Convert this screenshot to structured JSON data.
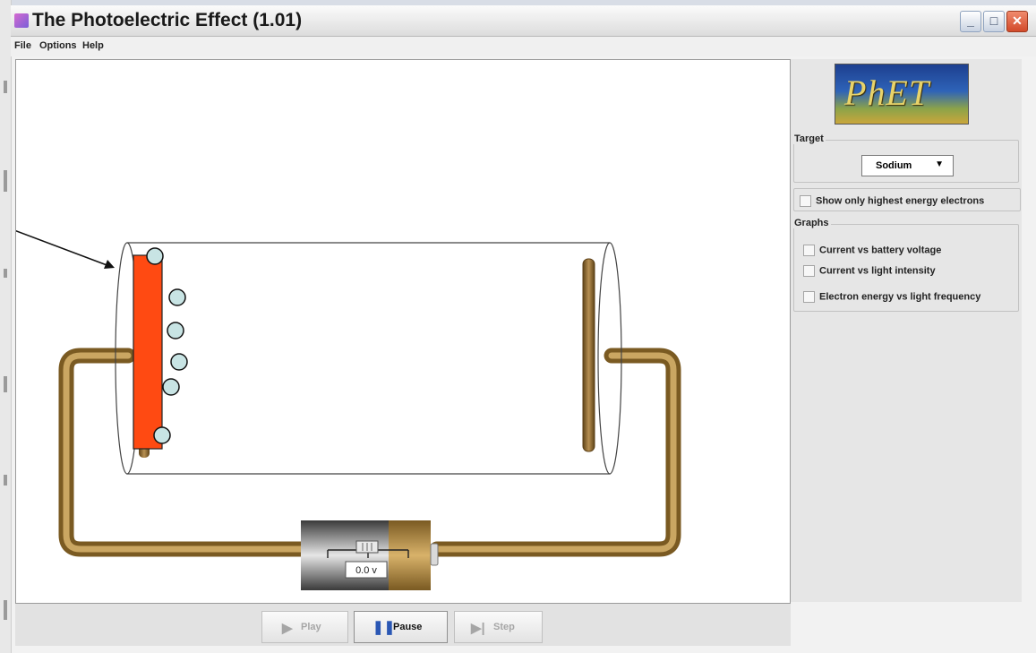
{
  "window": {
    "title": "The Photoelectric Effect (1.01)",
    "controls": {
      "minimize": "_",
      "maximize": "□",
      "close": "✕"
    }
  },
  "menu": {
    "items": [
      "File",
      "Options",
      "Help"
    ]
  },
  "simulation": {
    "battery_voltage": "0.0 v",
    "emitted_electrons": 6,
    "colors": {
      "target_plate": "#ff4a12",
      "electron": "#c8e4e4",
      "wire": "#8a6a2c"
    }
  },
  "control_panel": {
    "logo_text": "PhET",
    "target": {
      "label": "Target",
      "selected": "Sodium",
      "arrow": "▼"
    },
    "show_highest_energy": {
      "label": "Show only highest energy electrons",
      "checked": false
    },
    "graphs": {
      "label": "Graphs",
      "options": [
        {
          "label": "Current vs battery voltage",
          "checked": false
        },
        {
          "label": "Current vs light intensity",
          "checked": false
        },
        {
          "label": "Electron energy vs light frequency",
          "checked": false
        }
      ]
    }
  },
  "playback": {
    "play": {
      "label": "Play",
      "icon": "▶",
      "enabled": false
    },
    "pause": {
      "label": "Pause",
      "icon": "❚❚",
      "enabled": true
    },
    "step": {
      "label": "Step",
      "icon": "▶|",
      "enabled": false
    }
  }
}
